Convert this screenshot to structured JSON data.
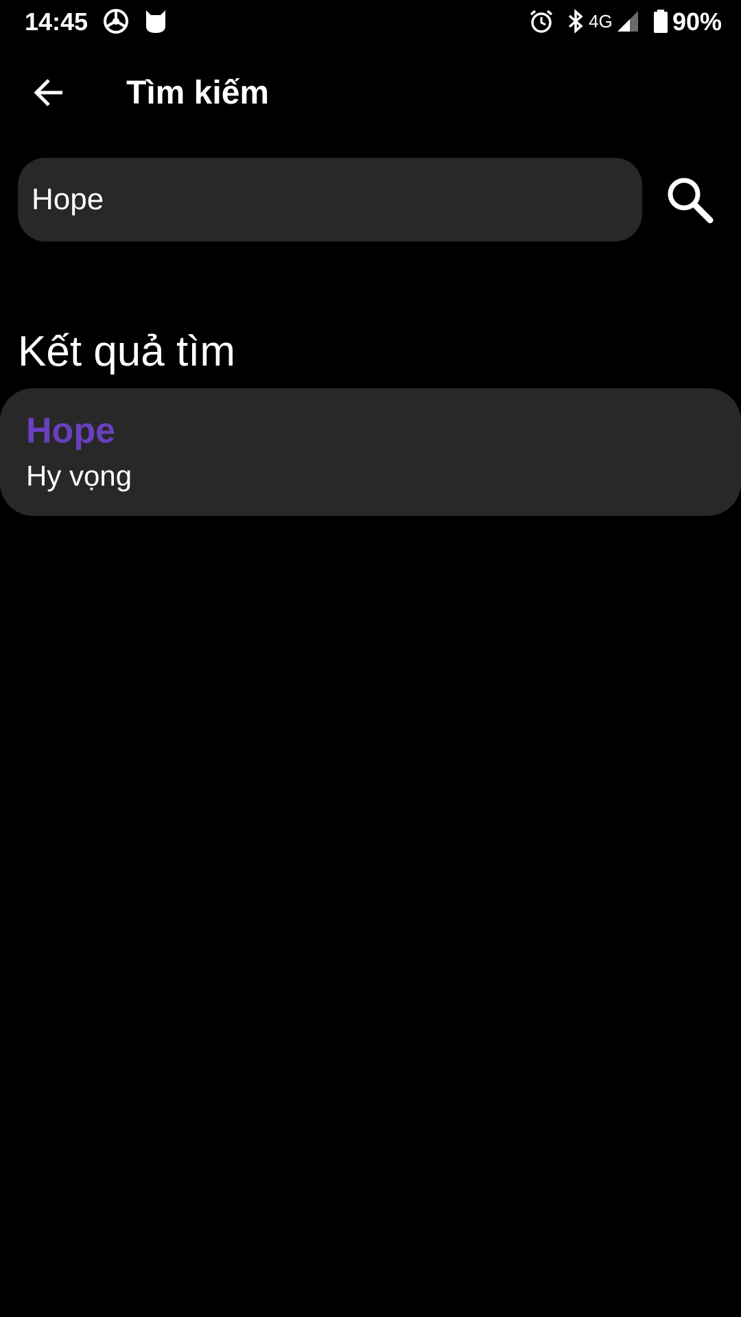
{
  "status_bar": {
    "time": "14:45",
    "left_icons": [
      "steering-wheel-icon",
      "app-mask-icon"
    ],
    "right_icons": [
      "alarm-icon",
      "bluetooth-icon",
      "signal-icon",
      "battery-icon"
    ],
    "network": "4G",
    "battery": "90%"
  },
  "app_bar": {
    "back_icon": "arrow-left-icon",
    "title": "Tìm kiếm"
  },
  "search": {
    "value": "Hope",
    "placeholder": "",
    "button_icon": "search-icon"
  },
  "results": {
    "heading": "Kết quả tìm",
    "items": [
      {
        "word": "Hope",
        "meaning": "Hy vọng"
      }
    ]
  },
  "colors": {
    "background": "#000000",
    "surface": "#282828",
    "accent": "#6A3FBF",
    "text": "#FFFFFF"
  }
}
